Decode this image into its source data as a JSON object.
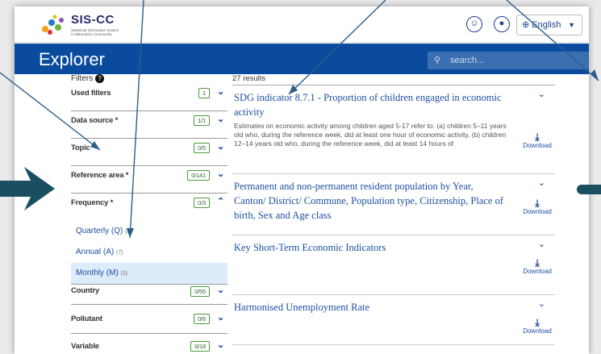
{
  "header": {
    "logo_text": "SIS-CC",
    "logo_subtext": "Statistical Information System Collaboration Community",
    "language": "English",
    "brand": "Explorer",
    "search_placeholder": "search..."
  },
  "filters": {
    "title": "Filters",
    "items": [
      {
        "label": "Used filters",
        "count": "1"
      },
      {
        "label": "Data source *",
        "count": "1/1"
      },
      {
        "label": "Topic",
        "count": "0/5"
      },
      {
        "label": "Reference area *",
        "count": "0/141"
      },
      {
        "label": "Frequency *",
        "count": "0/3"
      }
    ],
    "frequency_options": [
      {
        "label": "Quarterly (Q)",
        "count": "(8)"
      },
      {
        "label": "Annual (A)",
        "count": "(7)"
      },
      {
        "label": "Monthly (M)",
        "count": "(3)"
      }
    ],
    "more_items": [
      {
        "label": "Country",
        "count": "0/55"
      },
      {
        "label": "Pollutant",
        "count": "0/6"
      },
      {
        "label": "Variable",
        "count": "0/18"
      }
    ]
  },
  "results": {
    "count_text": "27 results",
    "download_label": "Download",
    "items": [
      {
        "title": "SDG indicator 8.7.1 - Proportion of children engaged in economic activity",
        "desc": "Estimates on economic activity among children aged 5-17 refer to: (a) children 5–11 years old who, during the reference week, did at least one hour of economic activity, (b) children 12–14 years old who, during the reference week, did at least 14 hours of"
      },
      {
        "title": "Permanent and non-permanent resident population by Year, Canton/ District/ Commune, Population type, Citizenship, Place of birth, Sex and Age class",
        "desc": ""
      },
      {
        "title": "Key Short-Term Economic Indicators",
        "desc": ""
      },
      {
        "title": "Harmonised Unemployment Rate",
        "desc": ""
      }
    ]
  },
  "colors": {
    "brand_blue": "#0a4b9e",
    "link_blue": "#1d4fa0",
    "count_green": "#4a9a3a",
    "annotation": "#2a5e8a"
  }
}
